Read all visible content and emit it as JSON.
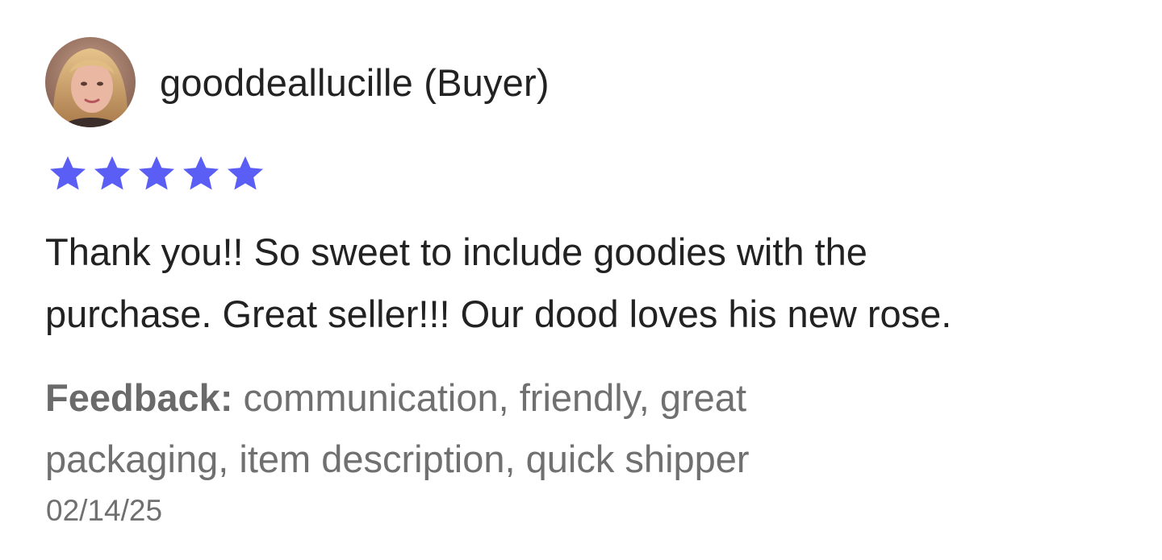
{
  "review": {
    "reviewer": {
      "name": "gooddeallucille (Buyer)",
      "avatar_icon": "profile-photo-avatar"
    },
    "rating": {
      "stars": 5,
      "max": 5,
      "star_color": "#5a5ef5",
      "icon": "star-icon"
    },
    "text_line_1": "Thank you!! So sweet to include goodies with the",
    "text_line_2": "purchase. Great seller!!! Our dood loves his new rose.",
    "feedback": {
      "label": "Feedback:",
      "values_line_1": " communication, friendly, great",
      "values_line_2": "packaging, item description, quick shipper"
    },
    "date": "02/14/25"
  }
}
